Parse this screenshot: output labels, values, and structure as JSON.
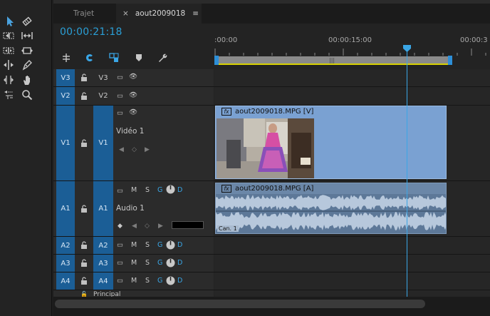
{
  "tabs": [
    {
      "label": "Trajet",
      "active": false
    },
    {
      "label": "aout2009018",
      "active": true,
      "close": "×",
      "menu": "≡"
    }
  ],
  "timecode": "00:00:21:18",
  "ruler": {
    "labels": [
      ":00:00",
      "00:00:15:00",
      "00:00:3"
    ]
  },
  "tracks": {
    "video": [
      {
        "src": "V3",
        "tgt": "V3"
      },
      {
        "src": "V2",
        "tgt": "V2"
      },
      {
        "src": "V1",
        "tgt": "V1",
        "name": "Vidéo 1"
      }
    ],
    "audio": [
      {
        "src": "A1",
        "tgt": "A1",
        "name": "Audio 1"
      },
      {
        "src": "A2",
        "tgt": "A2"
      },
      {
        "src": "A3",
        "tgt": "A3"
      },
      {
        "src": "A4",
        "tgt": "A4"
      }
    ],
    "mute_label": "M",
    "solo_label": "S",
    "g_label": "G",
    "d_label": "D"
  },
  "clips": {
    "video": {
      "label": "aout2009018.MPG [V]",
      "fx": "fx"
    },
    "audio": {
      "label": "aout2009018.MPG [A]",
      "fx": "fx",
      "channel": "Can. 1"
    }
  },
  "partial_row_label": "Principal",
  "colors": {
    "accent": "#2a9fd6",
    "track_target": "#1b5e96",
    "video_clip": "#7aa1d2",
    "audio_clip": "#5d7898",
    "work_area_line": "#d8d200"
  },
  "icons": [
    "selection-tool-icon",
    "track-select-icon",
    "ripple-edit-icon",
    "rolling-edit-icon",
    "rate-stretch-icon",
    "razor-icon",
    "slip-icon",
    "slide-icon",
    "pen-icon",
    "hand-icon",
    "zoom-icon",
    "snap-icon",
    "linked-selection-icon",
    "add-marker-icon",
    "wrench-icon"
  ]
}
